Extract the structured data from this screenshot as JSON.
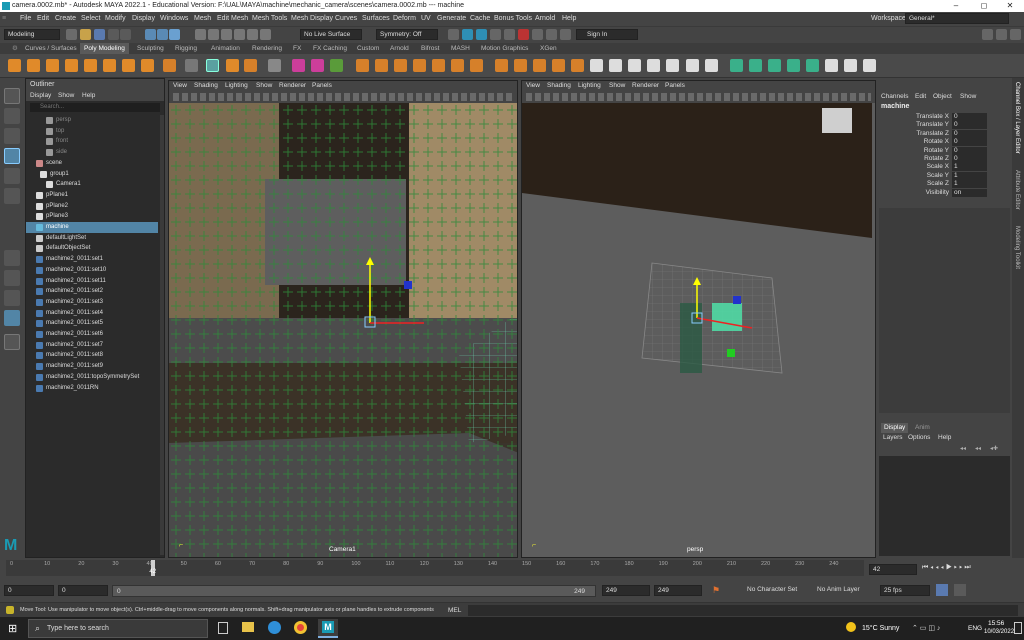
{
  "titlebar": {
    "title": "camera.0002.mb* - Autodesk MAYA 2022.1 - Educational Version: F:\\UAL\\MAYA\\machine\\mechanic_camera\\scenes\\camera.0002.mb --- machine",
    "minimize": "–",
    "maximize": "◻",
    "close": "✕"
  },
  "menubar": {
    "items": [
      "File",
      "Edit",
      "Create",
      "Select",
      "Modify",
      "Display",
      "Windows",
      "Mesh",
      "Edit Mesh",
      "Mesh Tools",
      "Mesh Display",
      "Curves",
      "Surfaces",
      "Deform",
      "UV",
      "Generate",
      "Cache",
      "Bonus Tools",
      "Arnold",
      "Help"
    ],
    "workspace_label": "Workspace:",
    "workspace_value": "General*"
  },
  "statusline": {
    "mode": "Modeling",
    "live_surface": "No Live Surface",
    "symmetry": "Symmetry: Off",
    "sign_in": "Sign In"
  },
  "shelf_tabs": [
    "Curves / Surfaces",
    "Poly Modeling",
    "Sculpting",
    "Rigging",
    "Animation",
    "Rendering",
    "FX",
    "FX Caching",
    "Custom",
    "Arnold",
    "Bifrost",
    "MASH",
    "Motion Graphics",
    "XGen"
  ],
  "shelf_active": "Poly Modeling",
  "outliner": {
    "title": "Outliner",
    "menu": [
      "Display",
      "Show",
      "Help"
    ],
    "search_placeholder": "Search...",
    "items": [
      {
        "label": "persp",
        "dim": true
      },
      {
        "label": "top",
        "dim": true
      },
      {
        "label": "front",
        "dim": true
      },
      {
        "label": "side",
        "dim": true
      },
      {
        "label": "scene",
        "dim": false
      },
      {
        "label": "group1",
        "dim": false
      },
      {
        "label": "Camera1",
        "dim": false
      },
      {
        "label": "pPlane1",
        "dim": false
      },
      {
        "label": "pPlane2",
        "dim": false
      },
      {
        "label": "pPlane3",
        "dim": false
      },
      {
        "label": "machine",
        "dim": false,
        "selected": true
      },
      {
        "label": "defaultLightSet",
        "dim": false
      },
      {
        "label": "defaultObjectSet",
        "dim": false
      },
      {
        "label": "machime2_0011:set1",
        "dim": false
      },
      {
        "label": "machime2_0011:set10",
        "dim": false
      },
      {
        "label": "machime2_0011:set11",
        "dim": false
      },
      {
        "label": "machime2_0011:set2",
        "dim": false
      },
      {
        "label": "machime2_0011:set3",
        "dim": false
      },
      {
        "label": "machime2_0011:set4",
        "dim": false
      },
      {
        "label": "machime2_0011:set5",
        "dim": false
      },
      {
        "label": "machime2_0011:set6",
        "dim": false
      },
      {
        "label": "machime2_0011:set7",
        "dim": false
      },
      {
        "label": "machime2_0011:set8",
        "dim": false
      },
      {
        "label": "machime2_0011:set9",
        "dim": false
      },
      {
        "label": "machime2_0011:topoSymmetrySet",
        "dim": false
      },
      {
        "label": "machime2_0011RN",
        "dim": false
      }
    ]
  },
  "viewport_menu": [
    "View",
    "Shading",
    "Lighting",
    "Show",
    "Renderer",
    "Panels"
  ],
  "viewport_left": {
    "camera_label": "Camera1"
  },
  "viewport_right": {
    "camera_label": "persp"
  },
  "channel_box": {
    "menu": [
      "Channels",
      "Edit",
      "Object",
      "Show"
    ],
    "object_name": "machine",
    "channels": [
      {
        "name": "Translate X",
        "value": "0"
      },
      {
        "name": "Translate Y",
        "value": "0"
      },
      {
        "name": "Translate Z",
        "value": "0"
      },
      {
        "name": "Rotate X",
        "value": "0"
      },
      {
        "name": "Rotate Y",
        "value": "0"
      },
      {
        "name": "Rotate Z",
        "value": "0"
      },
      {
        "name": "Scale X",
        "value": "1"
      },
      {
        "name": "Scale Y",
        "value": "1"
      },
      {
        "name": "Scale Z",
        "value": "1"
      },
      {
        "name": "Visibility",
        "value": "on"
      }
    ]
  },
  "side_tabs": [
    "Channel Box / Layer Editor",
    "Attribute Editor",
    "Modeling Toolkit"
  ],
  "layer_editor": {
    "tabs": [
      "Display",
      "Anim"
    ],
    "menu": [
      "Layers",
      "Options",
      "Help"
    ]
  },
  "time_slider": {
    "ticks": [
      "0",
      "10",
      "20",
      "30",
      "40",
      "50",
      "60",
      "70",
      "80",
      "90",
      "100",
      "110",
      "120",
      "130",
      "140",
      "150",
      "160",
      "170",
      "180",
      "190",
      "200",
      "210",
      "220",
      "230",
      "240"
    ],
    "current_frame": "42",
    "current_frame_field": "42"
  },
  "range_slider": {
    "start": "0",
    "anim_start": "0",
    "range_start_inner": "0",
    "range_end_inner": "249",
    "playback_end": "249",
    "anim_end": "249",
    "character_set": "No Character Set",
    "anim_layer": "No Anim Layer",
    "fps": "25 fps"
  },
  "help_line": {
    "text": "Move Tool: Use manipulator to move object(s). Ctrl+middle-drag to move components along normals. Shift+drag manipulator axis or plane handles to extrude components or c",
    "mel_label": "MEL"
  },
  "taskbar": {
    "search_placeholder": "Type here to search",
    "weather": "15°C  Sunny",
    "lang": "ENG",
    "time": "15:56",
    "date": "10/03/2022"
  }
}
